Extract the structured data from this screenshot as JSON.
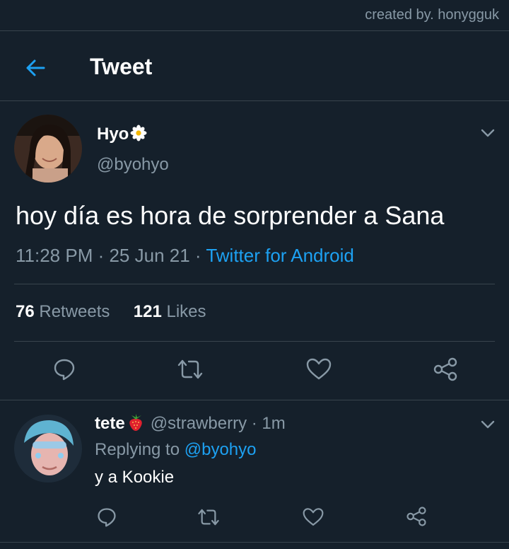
{
  "watermark": "created by. honygguk",
  "header": {
    "title": "Tweet",
    "back_icon": "arrow-left-icon"
  },
  "tweet": {
    "display_name": "Hyo",
    "name_emoji": "daisy-flower-icon",
    "handle": "@byohyo",
    "text": "hoy día es hora de sorprender a Sana",
    "time": "11:28 PM",
    "date": "25 Jun 21",
    "source": "Twitter for Android",
    "retweets_count": "76",
    "retweets_label": "Retweets",
    "likes_count": "121",
    "likes_label": "Likes",
    "actions": [
      "reply-icon",
      "retweet-icon",
      "like-icon",
      "share-icon"
    ]
  },
  "reply": {
    "display_name": "tete",
    "name_emoji": "strawberry-icon",
    "handle": "@strawberry",
    "age": "1m",
    "replying_prefix": "Replying to",
    "replying_to": "@byohyo",
    "text": "y a Kookie"
  },
  "colors": {
    "background": "#15202b",
    "accent": "#1da1f2",
    "secondary_text": "#8899a6",
    "divider": "#38444d"
  }
}
